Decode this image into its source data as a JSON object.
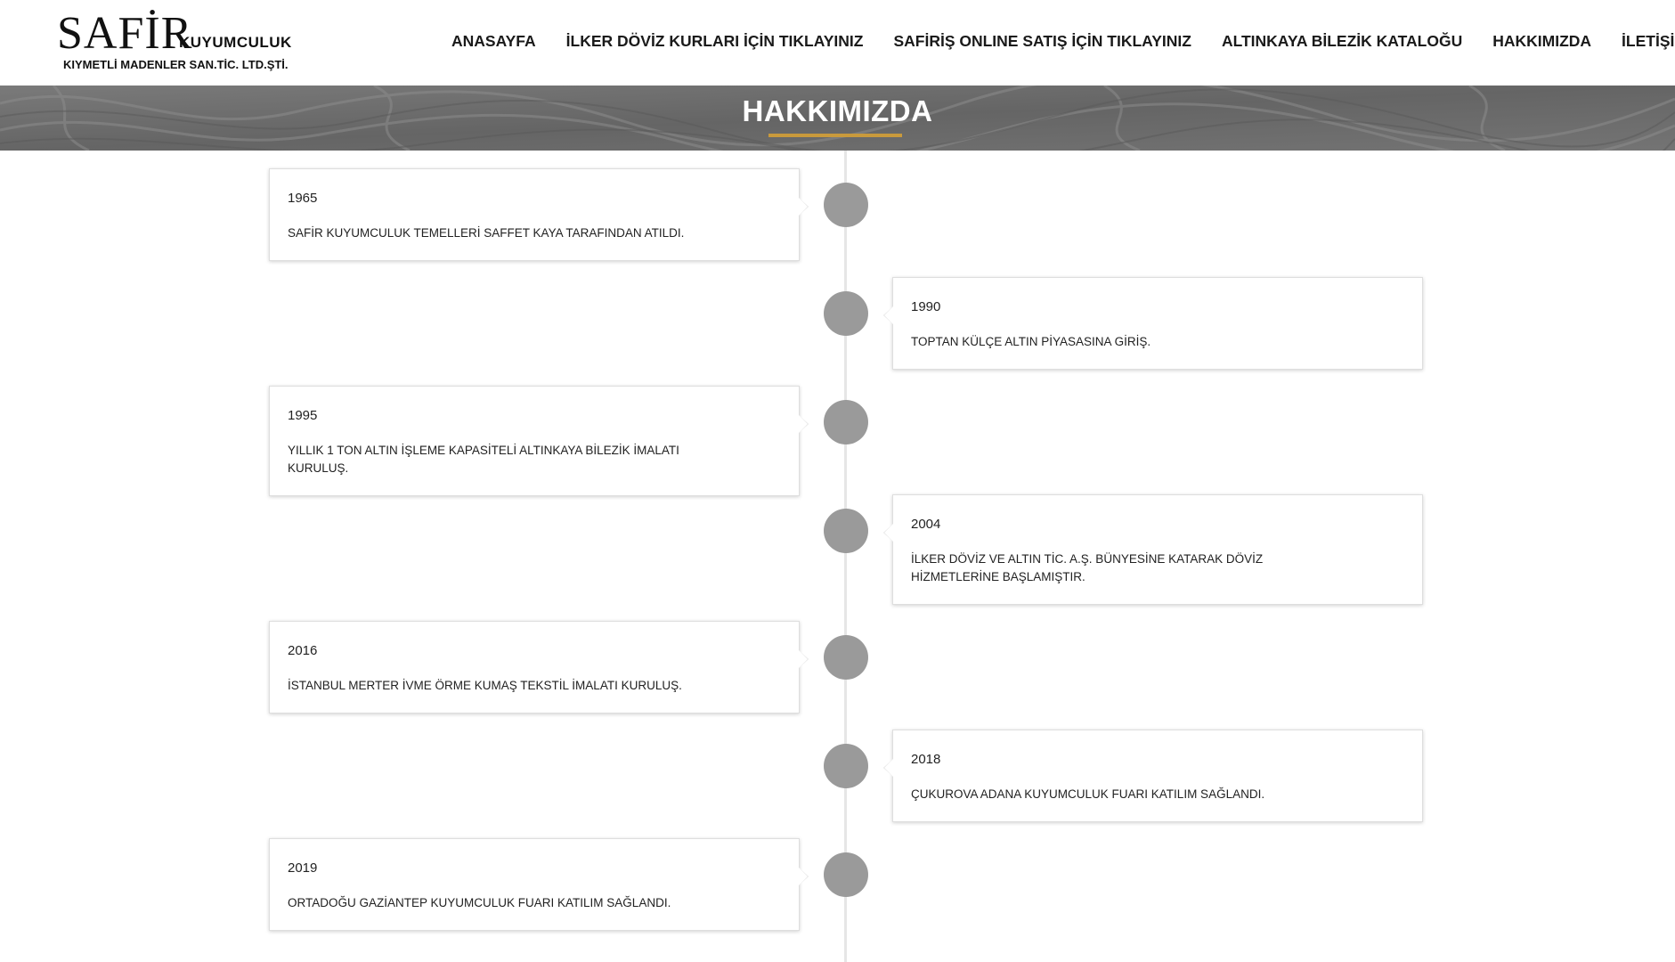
{
  "logo": {
    "main": "SAFİR",
    "sub": "KUYUMCULUK",
    "line2": "KIYMETLİ MADENLER SAN.TİC. LTD.ŞTİ."
  },
  "nav": [
    {
      "label": "ANASAYFA"
    },
    {
      "label": "İLKER DÖVİZ KURLARI İÇİN TIKLAYINIZ"
    },
    {
      "label": "SAFİRİŞ ONLINE SATIŞ İÇİN TIKLAYINIZ"
    },
    {
      "label": "ALTINKAYA BİLEZİK KATALOĞU"
    },
    {
      "label": "HAKKIMIZDA"
    },
    {
      "label": "İLETİŞİM"
    }
  ],
  "banner": {
    "title": "HAKKIMIZDA"
  },
  "timeline": [
    {
      "year": "1965",
      "text": "SAFİR KUYUMCULUK TEMELLERİ SAFFET KAYA TARAFINDAN ATILDI."
    },
    {
      "year": "1990",
      "text": "TOPTAN KÜLÇE ALTIN PİYASASINA GİRİŞ."
    },
    {
      "year": "1995",
      "text": "YILLIK 1 TON ALTIN İŞLEME KAPASİTELİ ALTINKAYA BİLEZİK İMALATI KURULUŞ."
    },
    {
      "year": "2004",
      "text": "İLKER DÖVİZ VE ALTIN TİC. A.Ş. BÜNYESİNE KATARAK DÖVİZ HİZMETLERİNE BAŞLAMIŞTIR."
    },
    {
      "year": "2016",
      "text": "İSTANBUL MERTER İVME ÖRME KUMAŞ TEKSTİL İMALATI KURULUŞ."
    },
    {
      "year": "2018",
      "text": "ÇUKUROVA ADANA KUYUMCULUK FUARI KATILIM SAĞLANDI."
    },
    {
      "year": "2019",
      "text": "ORTADOĞU GAZİANTEP KUYUMCULUK FUARI KATILIM SAĞLANDI."
    }
  ],
  "colors": {
    "accent": "#c99a3c",
    "banner_bg": "#6f6f6f",
    "dot": "#9a9a9a"
  }
}
